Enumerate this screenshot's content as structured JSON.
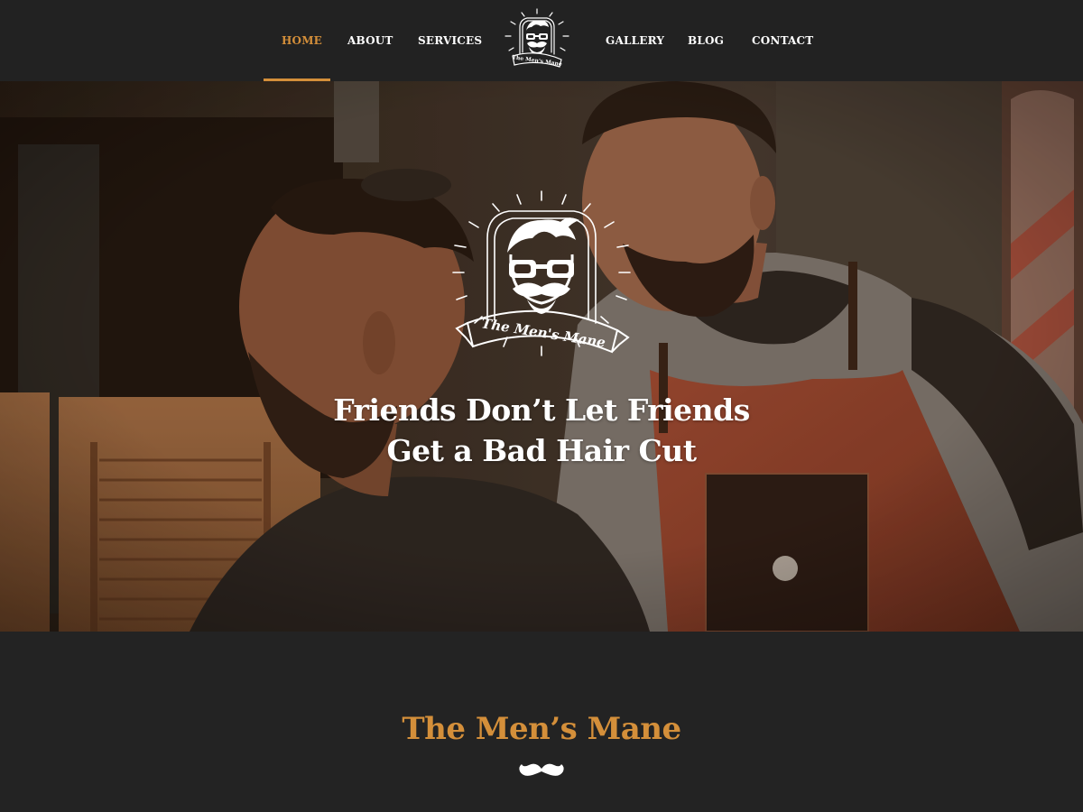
{
  "nav": {
    "items": [
      {
        "label": "HOME",
        "active": true
      },
      {
        "label": "ABOUT",
        "active": false
      },
      {
        "label": "SERVICES",
        "active": false
      },
      {
        "label": "GALLERY",
        "active": false
      },
      {
        "label": "BLOG",
        "active": false
      },
      {
        "label": "CONTACT",
        "active": false
      }
    ],
    "logo": {
      "text": "The Men's Mane",
      "icon": "barber-logo-icon"
    }
  },
  "hero": {
    "image": "barber-cutting-hair-photo",
    "logo": {
      "text": "The Men's Mane",
      "icon": "barber-logo-icon"
    },
    "headline": {
      "line1": "Friends Don’t Let Friends",
      "line2": "Get a Bad Hair Cut"
    }
  },
  "intro": {
    "title": "The Men’s Mane",
    "divider_icon": "mustache-icon"
  },
  "colors": {
    "background": "#232323",
    "accent": "#d48f3a",
    "text": "#ffffff"
  }
}
